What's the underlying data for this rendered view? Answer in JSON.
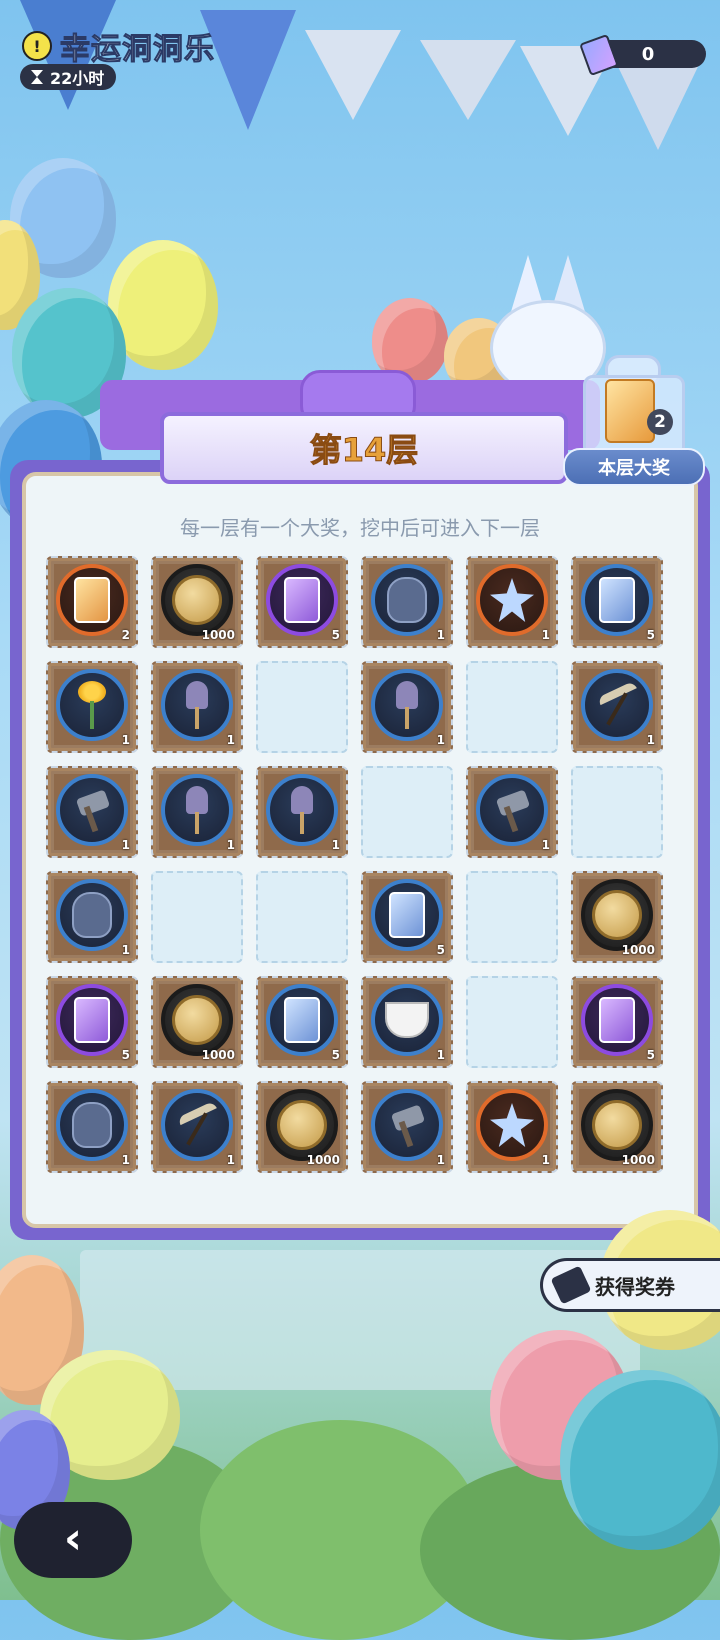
{
  "header": {
    "title": "幸运洞洞乐",
    "timer": "22小时",
    "ticket_count": "0"
  },
  "board": {
    "floor_title": "第14层",
    "subtitle": "每一层有一个大奖，挖中后可进入下一层",
    "grand_prize_count": "2",
    "grand_prize_label": "本层大奖"
  },
  "grid": [
    [
      {
        "icon": "gold-card",
        "ring": "orange",
        "qty": "2"
      },
      {
        "icon": "coin",
        "ring": "black",
        "qty": "1000"
      },
      {
        "icon": "violet-card",
        "ring": "purple",
        "qty": "5"
      },
      {
        "icon": "glove",
        "ring": "blue",
        "qty": "1"
      },
      {
        "icon": "crystal",
        "ring": "orange",
        "qty": "1"
      },
      {
        "icon": "blue-card",
        "ring": "blue",
        "qty": "5"
      }
    ],
    [
      {
        "icon": "flower",
        "ring": "blue",
        "qty": "1"
      },
      {
        "icon": "shovel",
        "ring": "blue",
        "qty": "1"
      },
      {
        "icon": "dug",
        "ring": "",
        "qty": ""
      },
      {
        "icon": "shovel",
        "ring": "blue",
        "qty": "1"
      },
      {
        "icon": "dug",
        "ring": "",
        "qty": ""
      },
      {
        "icon": "pickaxe",
        "ring": "blue",
        "qty": "1"
      }
    ],
    [
      {
        "icon": "hammer",
        "ring": "blue",
        "qty": "1"
      },
      {
        "icon": "shovel",
        "ring": "blue",
        "qty": "1"
      },
      {
        "icon": "shovel",
        "ring": "blue",
        "qty": "1"
      },
      {
        "icon": "dug",
        "ring": "",
        "qty": ""
      },
      {
        "icon": "hammer",
        "ring": "blue",
        "qty": "1"
      },
      {
        "icon": "dug",
        "ring": "",
        "qty": ""
      }
    ],
    [
      {
        "icon": "glove",
        "ring": "blue",
        "qty": "1"
      },
      {
        "icon": "dug",
        "ring": "",
        "qty": ""
      },
      {
        "icon": "dug",
        "ring": "",
        "qty": ""
      },
      {
        "icon": "blue-card",
        "ring": "blue",
        "qty": "5"
      },
      {
        "icon": "dug",
        "ring": "",
        "qty": ""
      },
      {
        "icon": "coin",
        "ring": "black",
        "qty": "1000"
      }
    ],
    [
      {
        "icon": "violet-card",
        "ring": "purple",
        "qty": "5"
      },
      {
        "icon": "coin",
        "ring": "black",
        "qty": "1000"
      },
      {
        "icon": "blue-card",
        "ring": "blue",
        "qty": "5"
      },
      {
        "icon": "teacup",
        "ring": "blue",
        "qty": "1"
      },
      {
        "icon": "dug",
        "ring": "",
        "qty": ""
      },
      {
        "icon": "violet-card",
        "ring": "purple",
        "qty": "5"
      }
    ],
    [
      {
        "icon": "glove",
        "ring": "blue",
        "qty": "1"
      },
      {
        "icon": "pickaxe",
        "ring": "blue",
        "qty": "1"
      },
      {
        "icon": "coin",
        "ring": "black",
        "qty": "1000"
      },
      {
        "icon": "hammer",
        "ring": "blue",
        "qty": "1"
      },
      {
        "icon": "crystal",
        "ring": "orange",
        "qty": "1"
      },
      {
        "icon": "coin",
        "ring": "black",
        "qty": "1000"
      }
    ]
  ],
  "actions": {
    "get_tickets": "获得奖券"
  },
  "colors": {
    "sky": "#7fc4ef",
    "board": "#7865cf",
    "banner_text": "#e7a13a"
  }
}
